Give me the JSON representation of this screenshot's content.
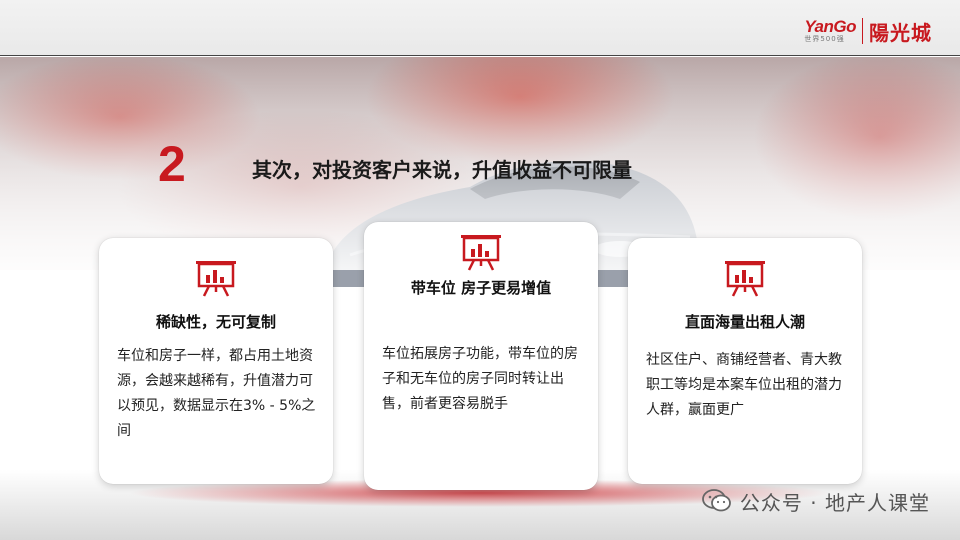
{
  "header": {
    "logo_brand": "YanGo",
    "logo_sub": "世界500强",
    "logo_cn": "陽光城"
  },
  "headline": {
    "number": "2",
    "text": "其次，对投资客户来说，升值收益不可限量"
  },
  "cards": [
    {
      "icon": "presentation-board-icon",
      "title": "稀缺性，无可复制",
      "body": "车位和房子一样，都占用土地资源，会越来越稀有，升值潜力可以预见，数据显示在3% - 5%之间"
    },
    {
      "icon": "presentation-board-icon",
      "title": "带车位 房子更易增值",
      "body": "车位拓展房子功能，带车位的房子和无车位的房子同时转让出售，前者更容易脱手"
    },
    {
      "icon": "presentation-board-icon",
      "title": "直面海量出租人潮",
      "body": "社区住户、商铺经营者、青大教职工等均是本案车位出租的潜力人群，赢面更广"
    }
  ],
  "watermark": {
    "icon": "wechat-icon",
    "text": "公众号 · 地产人课堂"
  },
  "colors": {
    "accent": "#c8191f",
    "text": "#1a1a1a"
  }
}
